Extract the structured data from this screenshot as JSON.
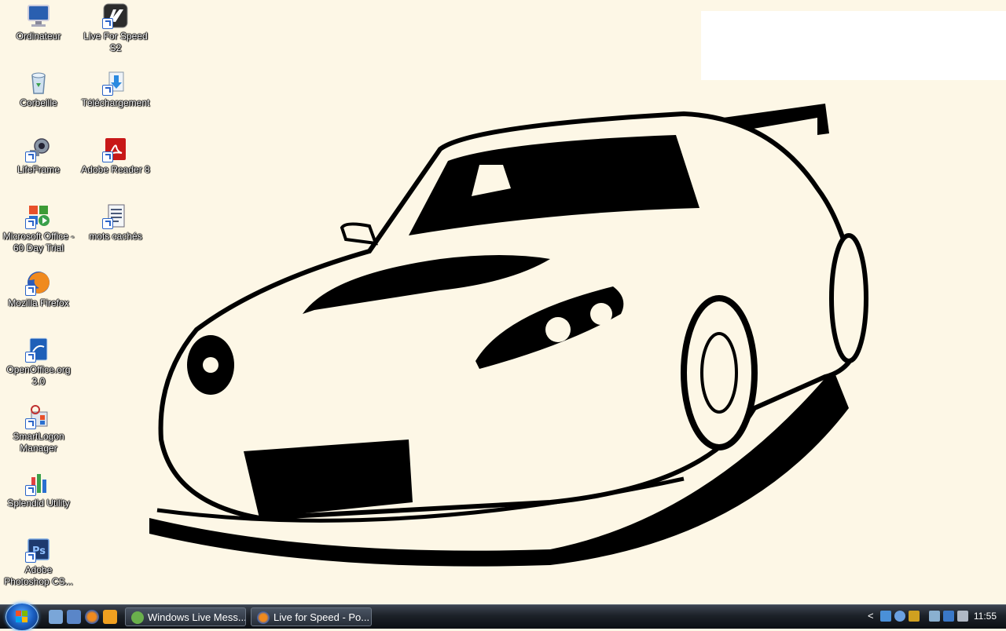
{
  "desktop": {
    "icons": [
      {
        "label": "Ordinateur",
        "icon": "computer-icon"
      },
      {
        "label": "Live For Speed S2",
        "icon": "lfs-icon"
      },
      {
        "label": "Corbeille",
        "icon": "recycle-bin-icon"
      },
      {
        "label": "Téléchargement",
        "icon": "download-folder-icon"
      },
      {
        "label": "LifeFrame",
        "icon": "webcam-icon"
      },
      {
        "label": "Adobe Reader 8",
        "icon": "adobe-reader-icon"
      },
      {
        "label": "Microsoft Office - 60 Day Trial",
        "icon": "office-icon"
      },
      {
        "label": "mots cachés",
        "icon": "document-icon"
      },
      {
        "label": "Mozilla Firefox",
        "icon": "firefox-icon"
      },
      {
        "label": "OpenOffice.org 3.0",
        "icon": "openoffice-icon"
      },
      {
        "label": "SmartLogon Manager",
        "icon": "smartlogon-icon"
      },
      {
        "label": "Splendid Utility",
        "icon": "splendid-icon"
      },
      {
        "label": "Adobe Photoshop CS...",
        "icon": "photoshop-icon"
      }
    ]
  },
  "taskbar": {
    "tasks": [
      {
        "label": "Windows Live Mess...",
        "icon": "messenger-icon"
      },
      {
        "label": "Live for Speed - Po...",
        "icon": "firefox-icon"
      }
    ],
    "clock": "11:55",
    "tray_chevron": "<"
  },
  "colors": {
    "wallpaper_bg": "#fdf7e6",
    "taskbar": "#1c2128",
    "accent": "#1b5fc2"
  }
}
